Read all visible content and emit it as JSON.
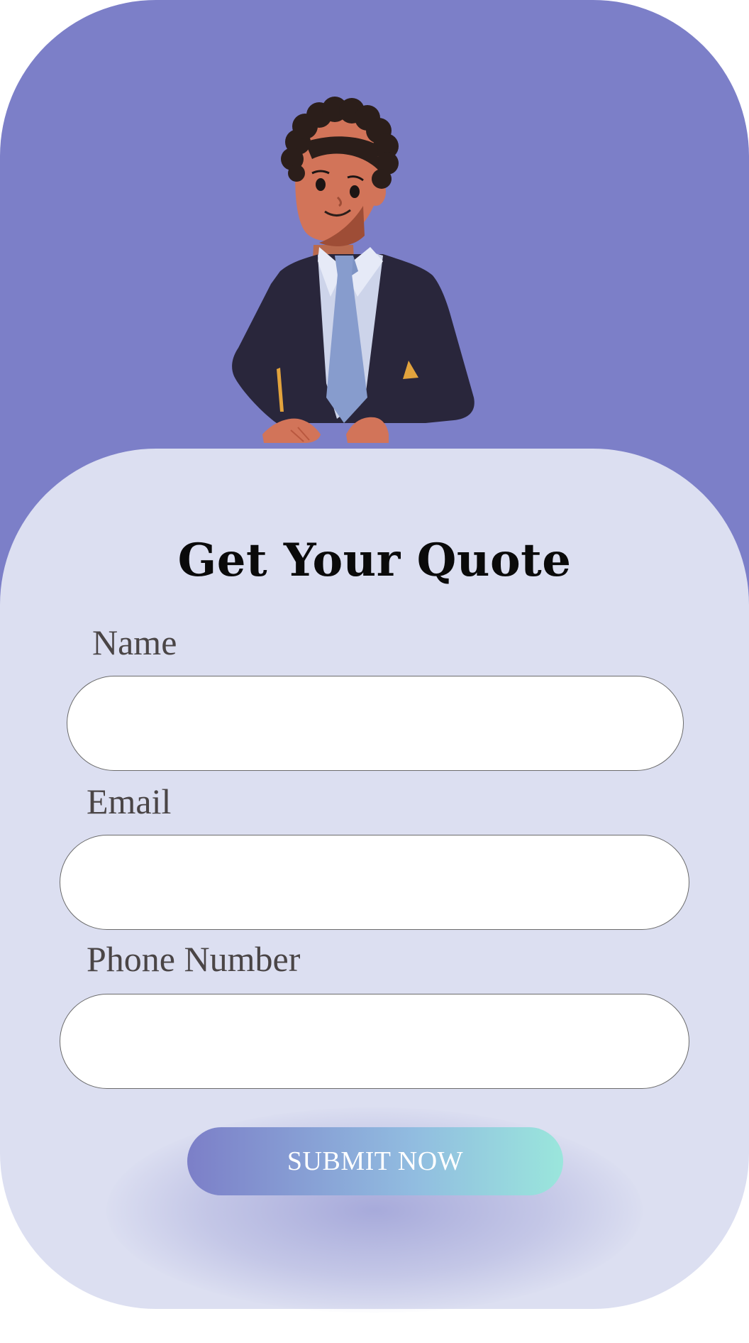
{
  "form": {
    "title": "Get Your Quote",
    "fields": [
      {
        "label": "Name",
        "value": "",
        "placeholder": ""
      },
      {
        "label": "Email",
        "value": "",
        "placeholder": ""
      },
      {
        "label": "Phone Number",
        "value": "",
        "placeholder": ""
      }
    ],
    "submit_label": "SUBMIT NOW"
  },
  "colors": {
    "header_background": "#7c7fc8",
    "card_background": "#dcdff1",
    "button_gradient_start": "#7c7fc8",
    "button_gradient_end": "#9ae6dc",
    "title_text": "#0a0a0a",
    "label_text": "#4a4546"
  }
}
